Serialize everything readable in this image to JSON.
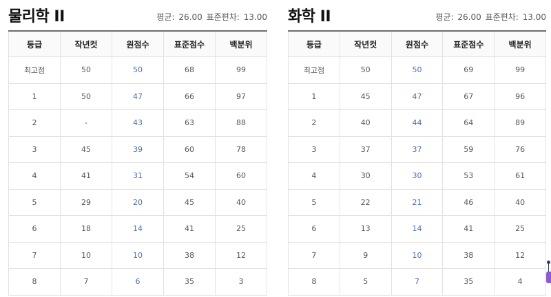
{
  "headers": [
    "등급",
    "작년컷",
    "원점수",
    "표준점수",
    "백분위"
  ],
  "left": {
    "title": "물리학 II",
    "mean_label": "평균:",
    "mean": "26.00",
    "sd_label": "표준편차:",
    "sd": "13.00",
    "rows": [
      [
        "최고점",
        "50",
        "50",
        "68",
        "99"
      ],
      [
        "1",
        "50",
        "47",
        "66",
        "97"
      ],
      [
        "2",
        "-",
        "43",
        "63",
        "88"
      ],
      [
        "3",
        "45",
        "39",
        "60",
        "78"
      ],
      [
        "4",
        "41",
        "31",
        "54",
        "60"
      ],
      [
        "5",
        "29",
        "20",
        "45",
        "40"
      ],
      [
        "6",
        "18",
        "14",
        "41",
        "25"
      ],
      [
        "7",
        "10",
        "10",
        "38",
        "12"
      ],
      [
        "8",
        "7",
        "6",
        "35",
        "3"
      ]
    ]
  },
  "right": {
    "title": "화학 II",
    "mean_label": "평균:",
    "mean": "26.00",
    "sd_label": "표준편차:",
    "sd": "13.00",
    "rows": [
      [
        "최고점",
        "50",
        "50",
        "69",
        "99"
      ],
      [
        "1",
        "45",
        "47",
        "67",
        "96"
      ],
      [
        "2",
        "40",
        "44",
        "64",
        "89"
      ],
      [
        "3",
        "37",
        "37",
        "59",
        "76"
      ],
      [
        "4",
        "30",
        "30",
        "53",
        "61"
      ],
      [
        "5",
        "22",
        "21",
        "46",
        "40"
      ],
      [
        "6",
        "13",
        "14",
        "41",
        "25"
      ],
      [
        "7",
        "9",
        "10",
        "38",
        "12"
      ],
      [
        "8",
        "5",
        "7",
        "35",
        "4"
      ]
    ]
  },
  "colors": {
    "raw_score": "#4a6fb3",
    "widget": "#8e5bd6"
  }
}
